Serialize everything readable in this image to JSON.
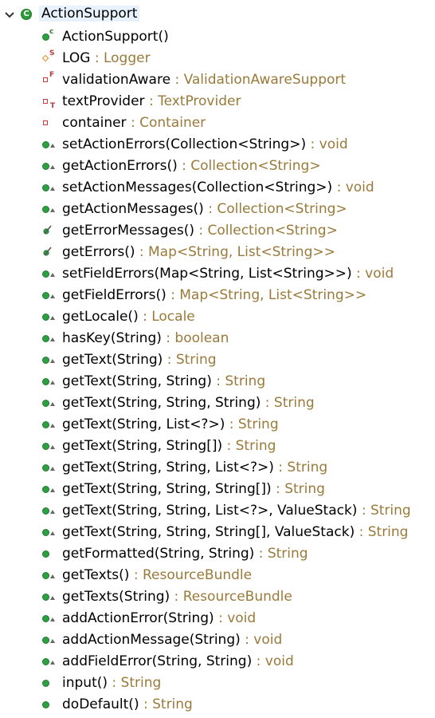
{
  "root": {
    "label": "ActionSupport",
    "expanded": true,
    "class_icon_letter": "C"
  },
  "members": [
    {
      "name": "ActionSupport()",
      "type": "",
      "icon": "constructor-icon"
    },
    {
      "name": "LOG",
      "type": " : Logger",
      "icon": "static-field-icon"
    },
    {
      "name": "validationAware",
      "type": " : ValidationAwareSupport",
      "icon": "final-field-icon"
    },
    {
      "name": "textProvider",
      "type": " : TextProvider",
      "icon": "transient-field-icon"
    },
    {
      "name": "container",
      "type": " : Container",
      "icon": "private-field-icon"
    },
    {
      "name": "setActionErrors(Collection<String>)",
      "type": " : void",
      "icon": "public-method-icon"
    },
    {
      "name": "getActionErrors()",
      "type": " : Collection<String>",
      "icon": "public-method-icon"
    },
    {
      "name": "setActionMessages(Collection<String>)",
      "type": " : void",
      "icon": "public-method-icon"
    },
    {
      "name": "getActionMessages()",
      "type": " : Collection<String>",
      "icon": "public-method-icon"
    },
    {
      "name": "getErrorMessages()",
      "type": " : Collection<String>",
      "icon": "deprecated-method-icon"
    },
    {
      "name": "getErrors()",
      "type": " : Map<String, List<String>>",
      "icon": "deprecated-method-icon"
    },
    {
      "name": "setFieldErrors(Map<String, List<String>>)",
      "type": " : void",
      "icon": "public-method-icon"
    },
    {
      "name": "getFieldErrors()",
      "type": " : Map<String, List<String>>",
      "icon": "public-method-icon"
    },
    {
      "name": "getLocale()",
      "type": " : Locale",
      "icon": "public-method-icon"
    },
    {
      "name": "hasKey(String)",
      "type": " : boolean",
      "icon": "public-method-icon"
    },
    {
      "name": "getText(String)",
      "type": " : String",
      "icon": "public-method-icon"
    },
    {
      "name": "getText(String, String)",
      "type": " : String",
      "icon": "public-method-icon"
    },
    {
      "name": "getText(String, String, String)",
      "type": " : String",
      "icon": "public-method-icon"
    },
    {
      "name": "getText(String, List<?>)",
      "type": " : String",
      "icon": "public-method-icon"
    },
    {
      "name": "getText(String, String[])",
      "type": " : String",
      "icon": "public-method-icon"
    },
    {
      "name": "getText(String, String, List<?>)",
      "type": " : String",
      "icon": "public-method-icon"
    },
    {
      "name": "getText(String, String, String[])",
      "type": " : String",
      "icon": "public-method-icon"
    },
    {
      "name": "getText(String, String, List<?>, ValueStack)",
      "type": " : String",
      "icon": "public-method-icon"
    },
    {
      "name": "getText(String, String, String[], ValueStack)",
      "type": " : String",
      "icon": "public-method-icon"
    },
    {
      "name": "getFormatted(String, String)",
      "type": " : String",
      "icon": "plain-method-icon"
    },
    {
      "name": "getTexts()",
      "type": " : ResourceBundle",
      "icon": "public-method-icon"
    },
    {
      "name": "getTexts(String)",
      "type": " : ResourceBundle",
      "icon": "public-method-icon"
    },
    {
      "name": "addActionError(String)",
      "type": " : void",
      "icon": "public-method-icon"
    },
    {
      "name": "addActionMessage(String)",
      "type": " : void",
      "icon": "public-method-icon"
    },
    {
      "name": "addFieldError(String, String)",
      "type": " : void",
      "icon": "public-method-icon"
    },
    {
      "name": "input()",
      "type": " : String",
      "icon": "plain-method-icon"
    },
    {
      "name": "doDefault()",
      "type": " : String",
      "icon": "plain-method-icon"
    }
  ],
  "colors": {
    "return_type": "#9a7a3a",
    "method_icon_green": "#2ea043",
    "field_icon_red": "#c43c3c",
    "static_icon_orange": "#d88a1a",
    "selection": "#e8f2fc"
  }
}
